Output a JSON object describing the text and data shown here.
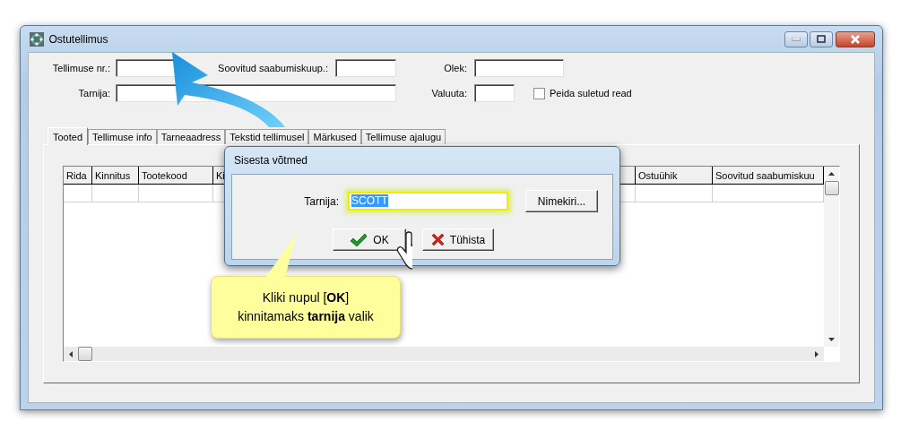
{
  "window": {
    "title": "Ostutellimus"
  },
  "form": {
    "order_no": {
      "label": "Tellimuse nr.:"
    },
    "arrival_date": {
      "label": "Soovitud saabumiskuup.:"
    },
    "status": {
      "label": "Olek:"
    },
    "supplier": {
      "label": "Tarnija:"
    },
    "currency": {
      "label": "Valuuta:"
    },
    "hide_closed": {
      "label": "Peida suletud read",
      "checked": false
    }
  },
  "tabs": [
    {
      "label": "Tooted",
      "selected": true
    },
    {
      "label": "Tellimuse info",
      "selected": false
    },
    {
      "label": "Tarneaadress",
      "selected": false
    },
    {
      "label": "Tekstid tellimusel",
      "selected": false
    },
    {
      "label": "Märkused",
      "selected": false
    },
    {
      "label": "Tellimuse ajalugu",
      "selected": false
    }
  ],
  "grid": {
    "columns": [
      "Rida",
      "Kinnitus",
      "Tootekood",
      "Ki",
      "Ostuühik",
      "Soovitud saabumiskuu"
    ]
  },
  "dialog": {
    "title": "Sisesta võtmed",
    "field": {
      "label": "Tarnija:",
      "value": "SCOTT",
      "text_selected": true,
      "highlighted": true
    },
    "buttons": [
      {
        "kind": "list",
        "label": "Nimekiri..."
      },
      {
        "kind": "ok",
        "label": "OK"
      },
      {
        "kind": "cancel",
        "label": "Tühista"
      }
    ]
  },
  "callout": {
    "lines": [
      "Kliki nupul [**OK**]",
      "kinnitamaks **tarnija** valik"
    ]
  }
}
